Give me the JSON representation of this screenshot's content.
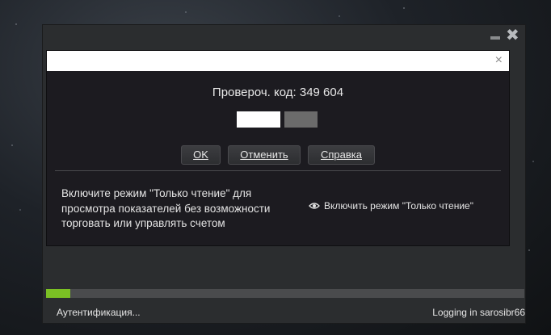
{
  "dialog": {
    "close_symbol": "×",
    "code_label": "Провероч. код: 349 604",
    "buttons": {
      "ok_label": "OK",
      "cancel_label": "Отменить",
      "help_label": "Справка"
    },
    "info_line1": "Включите режим \"Только чтение\" для",
    "info_line2": "просмотра показателей без возможности",
    "info_line3": "торговать или управлять счетом",
    "readonly_link": "Включить режим \"Только чтение\""
  },
  "window": {
    "close_symbol": "✖"
  },
  "progress": {
    "fraction": 0.05,
    "color": "#7bc024"
  },
  "status": {
    "left": "Аутентификация...",
    "right": "Logging in sarosibr66"
  },
  "icons": [
    "minimize-icon",
    "close-icon",
    "eye-icon"
  ]
}
